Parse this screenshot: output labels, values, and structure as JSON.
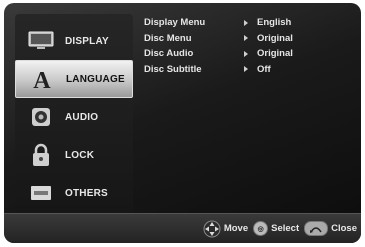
{
  "sidebar": {
    "items": [
      {
        "label": "DISPLAY",
        "icon": "tv-icon",
        "active": false
      },
      {
        "label": "LANGUAGE",
        "icon": "letter-a-icon",
        "active": true
      },
      {
        "label": "AUDIO",
        "icon": "speaker-icon",
        "active": false
      },
      {
        "label": "LOCK",
        "icon": "padlock-icon",
        "active": false
      },
      {
        "label": "OTHERS",
        "icon": "others-icon",
        "active": false
      }
    ]
  },
  "settings": [
    {
      "label": "Display Menu",
      "value": "English"
    },
    {
      "label": "Disc Menu",
      "value": "Original"
    },
    {
      "label": "Disc Audio",
      "value": "Original"
    },
    {
      "label": "Disc Subtitle",
      "value": "Off"
    }
  ],
  "footer": {
    "move_label": "Move",
    "select_label": "Select",
    "close_label": "Close"
  },
  "colors": {
    "accent_active": "#d8d8d8",
    "background": "#1a1a1a"
  }
}
